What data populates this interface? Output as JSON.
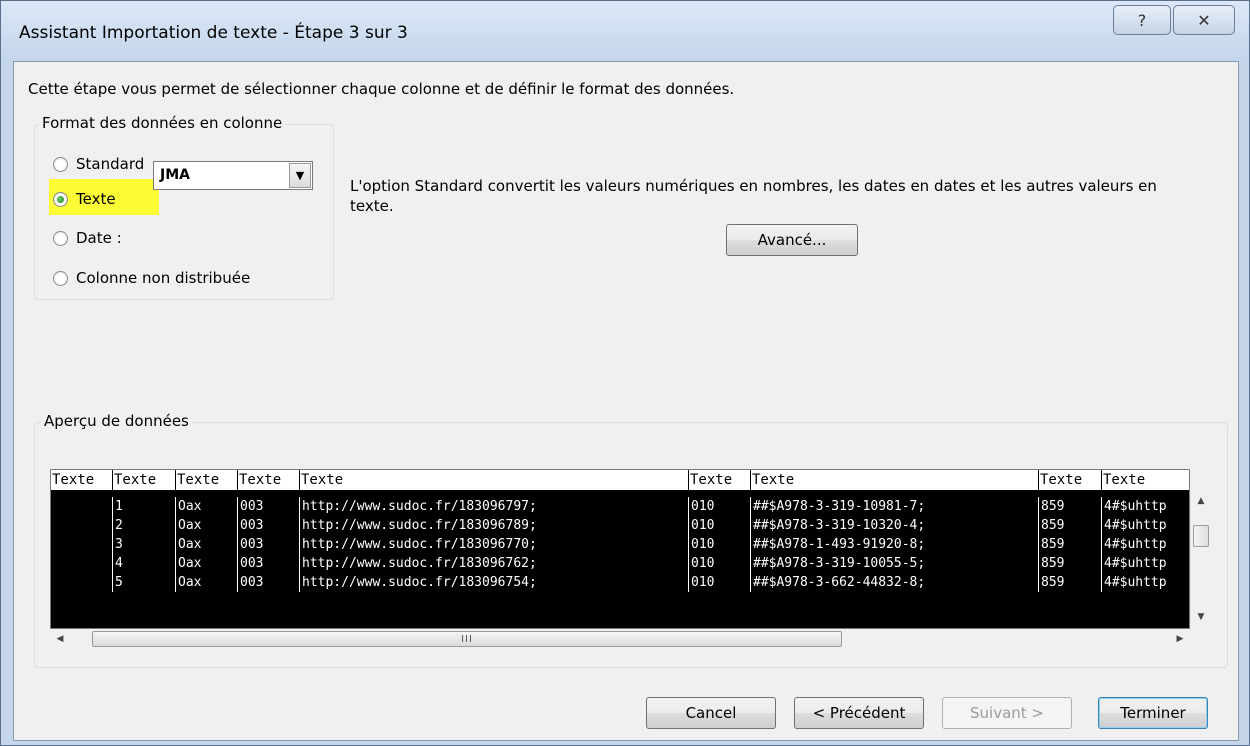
{
  "window": {
    "title": "Assistant Importation de texte - Étape 3 sur 3",
    "help_glyph": "?",
    "close_glyph": "✕"
  },
  "intro": "Cette étape vous permet de sélectionner chaque colonne et de définir le format des données.",
  "format_group": {
    "legend": "Format des données en colonne",
    "options": [
      {
        "label": "Standard",
        "selected": false
      },
      {
        "label": "Texte",
        "selected": true
      },
      {
        "label": "Date :",
        "selected": false
      },
      {
        "label": "Colonne non distribuée",
        "selected": false
      }
    ],
    "date_format": "JMA"
  },
  "description": "L'option Standard convertit les valeurs numériques en nombres, les dates en dates et les autres valeurs en texte.",
  "advanced_button": "Avancé...",
  "preview": {
    "legend": "Aperçu de données",
    "headers": [
      "Texte",
      "Texte",
      "Texte",
      "Texte",
      "Texte",
      "Texte",
      "Texte",
      "Texte",
      "Texte"
    ],
    "rows": [
      [
        "",
        "1",
        "Oax",
        "003",
        "http://www.sudoc.fr/183096797;",
        "010",
        "##$A978-3-319-10981-7;",
        "859",
        "4#$uhttp"
      ],
      [
        "",
        "2",
        "Oax",
        "003",
        "http://www.sudoc.fr/183096789;",
        "010",
        "##$A978-3-319-10320-4;",
        "859",
        "4#$uhttp"
      ],
      [
        "",
        "3",
        "Oax",
        "003",
        "http://www.sudoc.fr/183096770;",
        "010",
        "##$A978-1-493-91920-8;",
        "859",
        "4#$uhttp"
      ],
      [
        "",
        "4",
        "Oax",
        "003",
        "http://www.sudoc.fr/183096762;",
        "010",
        "##$A978-3-319-10055-5;",
        "859",
        "4#$uhttp"
      ],
      [
        "",
        "5",
        "Oax",
        "003",
        "http://www.sudoc.fr/183096754;",
        "010",
        "##$A978-3-662-44832-8;",
        "859",
        "4#$uhttp"
      ]
    ],
    "hscroll_grip": "III"
  },
  "buttons": {
    "cancel": "Cancel",
    "previous": "< Précédent",
    "next": "Suivant >",
    "finish": "Terminer"
  }
}
